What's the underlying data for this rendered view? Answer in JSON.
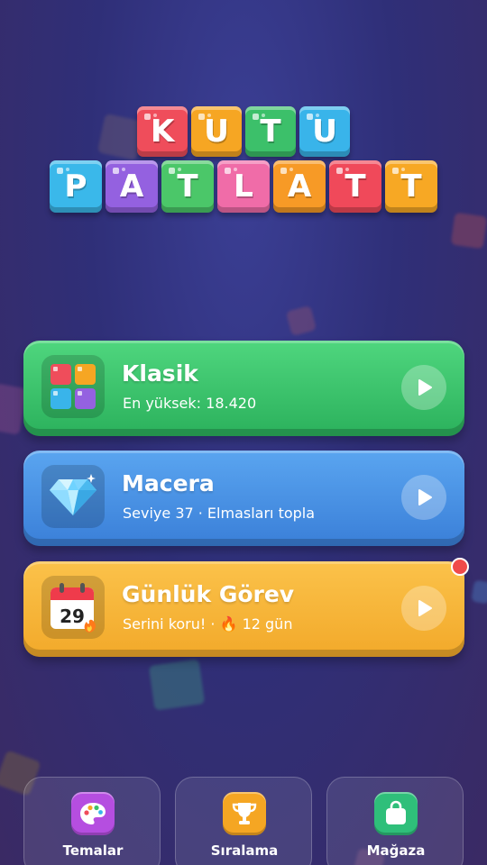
{
  "logo": {
    "row1": [
      {
        "letter": "K",
        "color": "#ef4d5b"
      },
      {
        "letter": "U",
        "color": "#f6a623"
      },
      {
        "letter": "T",
        "color": "#3cc06a"
      },
      {
        "letter": "U",
        "color": "#39b4ea"
      }
    ],
    "row2": [
      {
        "letter": "P",
        "color": "#3ab8ea"
      },
      {
        "letter": "A",
        "color": "#9461e0"
      },
      {
        "letter": "T",
        "color": "#4bc769"
      },
      {
        "letter": "L",
        "color": "#f06ca8"
      },
      {
        "letter": "A",
        "color": "#f79a26"
      },
      {
        "letter": "T",
        "color": "#f0495a"
      },
      {
        "letter": "T",
        "color": "#f7a824"
      }
    ]
  },
  "modes": {
    "klasik": {
      "title": "Klasik",
      "subtitle": "En yüksek: 18.420",
      "icon": "block-grid-icon"
    },
    "macera": {
      "title": "Macera",
      "subtitle": "Seviye 37 · Elmasları topla",
      "icon": "diamond-icon"
    },
    "gunluk": {
      "title": "Günlük Görev",
      "subtitle": "Serini koru! · 🔥 12 gün",
      "icon": "calendar-icon",
      "calendar_day": "29"
    }
  },
  "nav": {
    "temalar": {
      "label": "Temalar",
      "icon": "palette-icon",
      "color": "#b54ee0"
    },
    "siralama": {
      "label": "Sıralama",
      "icon": "trophy-icon",
      "color": "#f5a623"
    },
    "magaza": {
      "label": "Mağaza",
      "icon": "shopping-bag-icon",
      "color": "#2fbf7a"
    }
  },
  "colors": {
    "green": "#3cc06a",
    "blue": "#4a90e2",
    "orange": "#f5b335",
    "badge": "#f04a4a"
  }
}
